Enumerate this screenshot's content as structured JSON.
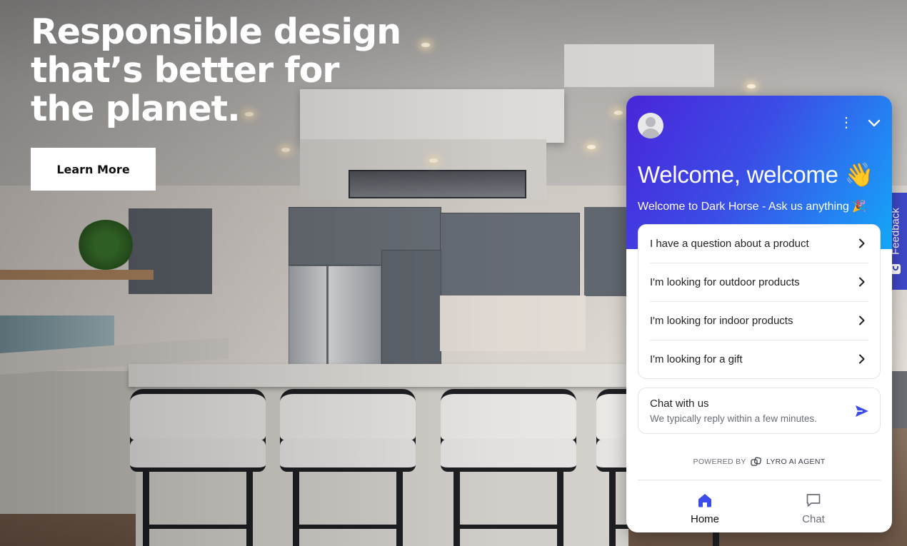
{
  "hero": {
    "title": "Responsible design that’s better for the planet.",
    "button_label": "Learn More"
  },
  "feedback_tab": {
    "label": "Feedback",
    "icon": "feedback-icon"
  },
  "chat_widget": {
    "avatar_icon": "user-avatar-icon",
    "menu_icon": "more-vertical-icon",
    "collapse_icon": "chevron-down-icon",
    "welcome_title": "Welcome, welcome 👋",
    "welcome_subtitle": "Welcome to Dark Horse - Ask us anything 🎉",
    "options": [
      {
        "label": "I have a question about a product"
      },
      {
        "label": "I'm looking for outdoor products"
      },
      {
        "label": "I'm looking for indoor products"
      },
      {
        "label": "I'm looking for a gift"
      }
    ],
    "chat_with_us": {
      "title": "Chat with us",
      "subtitle": "We typically reply within a few minutes.",
      "icon": "send-icon"
    },
    "powered_by": {
      "prefix": "POWERED BY",
      "brand": "LYRO AI AGENT"
    },
    "nav": {
      "home_label": "Home",
      "chat_label": "Chat"
    },
    "colors": {
      "header_start": "#4a25d9",
      "header_end": "#13a7f7",
      "accent": "#3b4de6"
    }
  }
}
